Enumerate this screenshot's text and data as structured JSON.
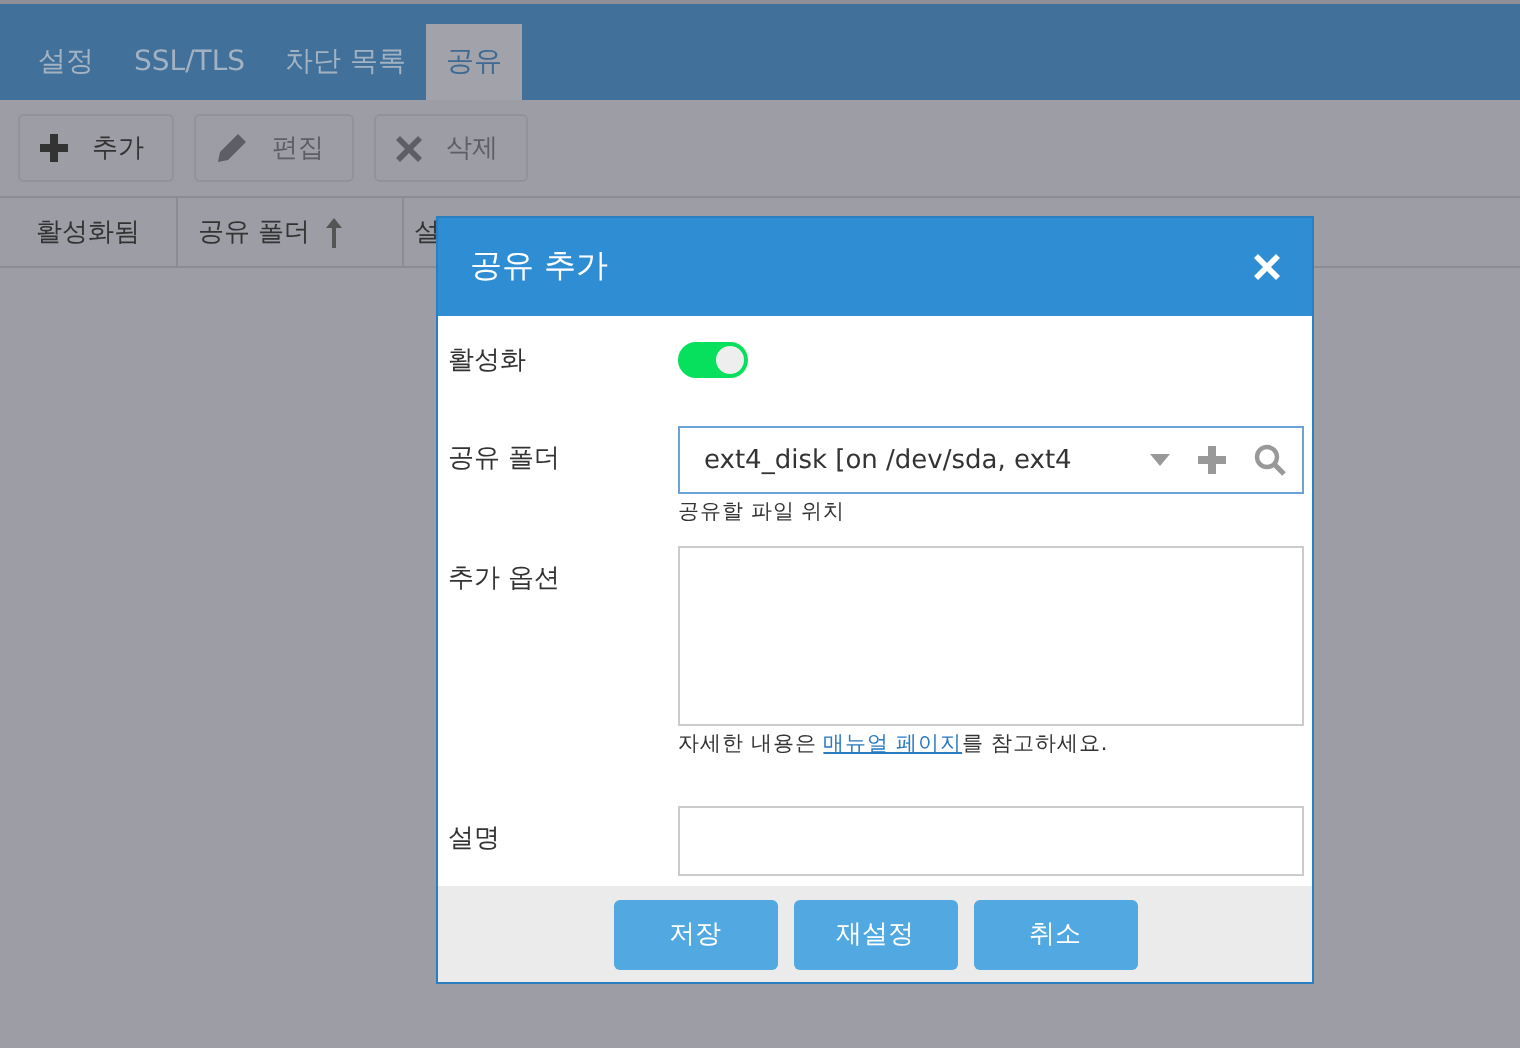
{
  "tabs": [
    {
      "label": "설정",
      "selected": false
    },
    {
      "label": "SSL/TLS",
      "selected": false
    },
    {
      "label": "차단 목록",
      "selected": false
    },
    {
      "label": "공유",
      "selected": true
    }
  ],
  "toolbar": [
    {
      "label": "추가",
      "disabled": false
    },
    {
      "label": "편집",
      "disabled": true
    },
    {
      "label": "삭제",
      "disabled": true
    }
  ],
  "table": {
    "columns": [
      {
        "label": "활성화됨",
        "sorted": false
      },
      {
        "label": "공유 폴더",
        "sorted": true
      },
      {
        "label": "설",
        "sorted": false
      }
    ]
  },
  "dialog": {
    "title": "공유 추가",
    "fields": [
      {
        "kind": "toggle",
        "label": "활성화",
        "on": true
      },
      {
        "kind": "select",
        "label": "공유 폴더",
        "value": "ext4_disk [on /dev/sda, ext4",
        "hint": "공유할 파일 위치"
      },
      {
        "kind": "textarea",
        "label": "추가 옵션",
        "hint_before": "자세한 내용은 ",
        "hint_link": "매뉴얼 페이지",
        "hint_after": "를 참고하세요."
      },
      {
        "kind": "input",
        "label": "설명"
      }
    ],
    "buttons": [
      "저장",
      "재설정",
      "취소"
    ]
  }
}
